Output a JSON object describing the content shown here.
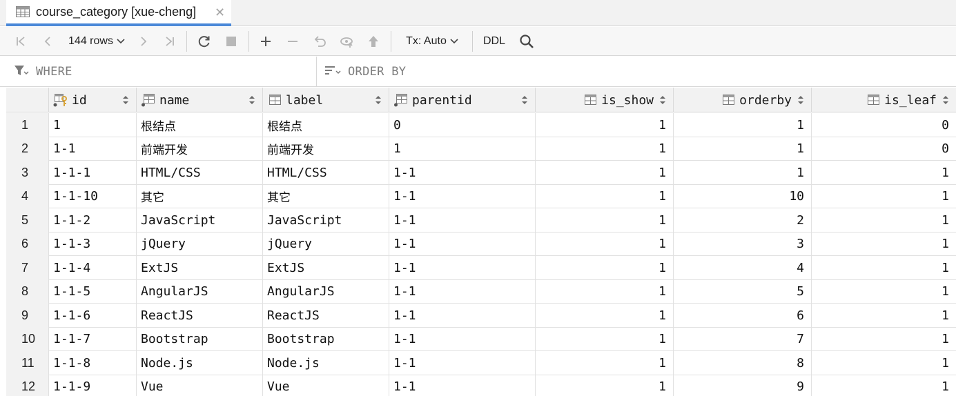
{
  "tab": {
    "title": "course_category [xue-cheng]",
    "close": "✕"
  },
  "toolbar": {
    "rows_label": "144 rows",
    "tx_label": "Tx: Auto",
    "ddl_label": "DDL"
  },
  "filter": {
    "where": "WHERE",
    "order_by": "ORDER BY"
  },
  "columns": [
    {
      "label": "id",
      "key": "pk"
    },
    {
      "label": "name"
    },
    {
      "label": "label"
    },
    {
      "label": "parentid"
    },
    {
      "label": "is_show"
    },
    {
      "label": "orderby"
    },
    {
      "label": "is_leaf"
    }
  ],
  "rows": [
    [
      "1",
      "1",
      "根结点",
      "根结点",
      "0",
      "1",
      "1",
      "0"
    ],
    [
      "2",
      "1-1",
      "前端开发",
      "前端开发",
      "1",
      "1",
      "1",
      "0"
    ],
    [
      "3",
      "1-1-1",
      "HTML/CSS",
      "HTML/CSS",
      "1-1",
      "1",
      "1",
      "1"
    ],
    [
      "4",
      "1-1-10",
      "其它",
      "其它",
      "1-1",
      "1",
      "10",
      "1"
    ],
    [
      "5",
      "1-1-2",
      "JavaScript",
      "JavaScript",
      "1-1",
      "1",
      "2",
      "1"
    ],
    [
      "6",
      "1-1-3",
      "jQuery",
      "jQuery",
      "1-1",
      "1",
      "3",
      "1"
    ],
    [
      "7",
      "1-1-4",
      "ExtJS",
      "ExtJS",
      "1-1",
      "1",
      "4",
      "1"
    ],
    [
      "8",
      "1-1-5",
      "AngularJS",
      "AngularJS",
      "1-1",
      "1",
      "5",
      "1"
    ],
    [
      "9",
      "1-1-6",
      "ReactJS",
      "ReactJS",
      "1-1",
      "1",
      "6",
      "1"
    ],
    [
      "10",
      "1-1-7",
      "Bootstrap",
      "Bootstrap",
      "1-1",
      "1",
      "7",
      "1"
    ],
    [
      "11",
      "1-1-8",
      "Node.js",
      "Node.js",
      "1-1",
      "1",
      "8",
      "1"
    ],
    [
      "12",
      "1-1-9",
      "Vue",
      "Vue",
      "1-1",
      "1",
      "9",
      "1"
    ]
  ],
  "colors": {
    "accent": "#4a88d8",
    "header_bg": "#f2f2f2",
    "icon": "#7a7a7a",
    "key": "#d9a53a"
  }
}
